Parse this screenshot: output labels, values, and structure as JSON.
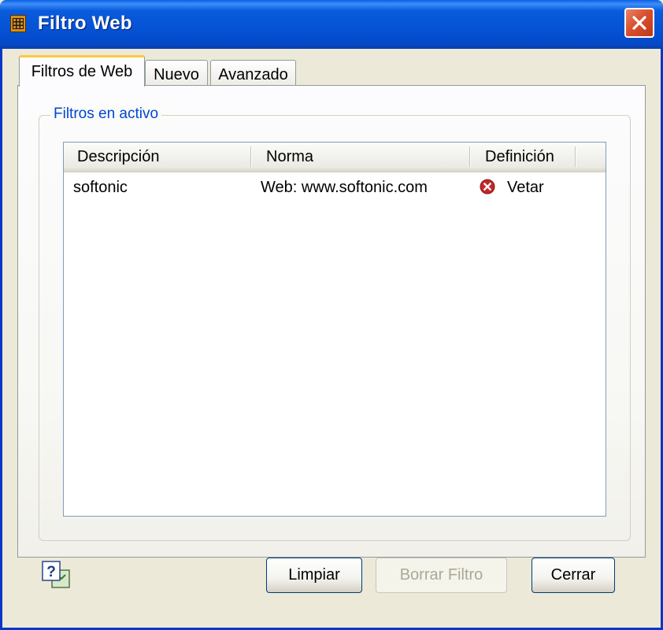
{
  "window": {
    "title": "Filtro Web"
  },
  "tabs": [
    {
      "label": "Filtros de Web",
      "active": true
    },
    {
      "label": "Nuevo",
      "active": false
    },
    {
      "label": "Avanzado",
      "active": false
    }
  ],
  "group": {
    "legend": "Filtros en activo"
  },
  "table": {
    "columns": [
      "Descripción",
      "Norma",
      "Definición"
    ],
    "rows": [
      {
        "descripcion": "softonic",
        "norma": "Web: www.softonic.com",
        "definicion": "Vetar",
        "definicion_icon": "deny-icon"
      }
    ]
  },
  "buttons": {
    "clear": "Limpiar",
    "delete_filter": "Borrar Filtro",
    "close": "Cerrar"
  },
  "icons": {
    "app": "app-icon",
    "close": "close-icon",
    "help": "help-icon"
  },
  "colors": {
    "titlebar": "#0552d5",
    "legend_text": "#0046d5",
    "deny_icon": "#c0282a",
    "active_tab_accent": "#ffc83c"
  }
}
